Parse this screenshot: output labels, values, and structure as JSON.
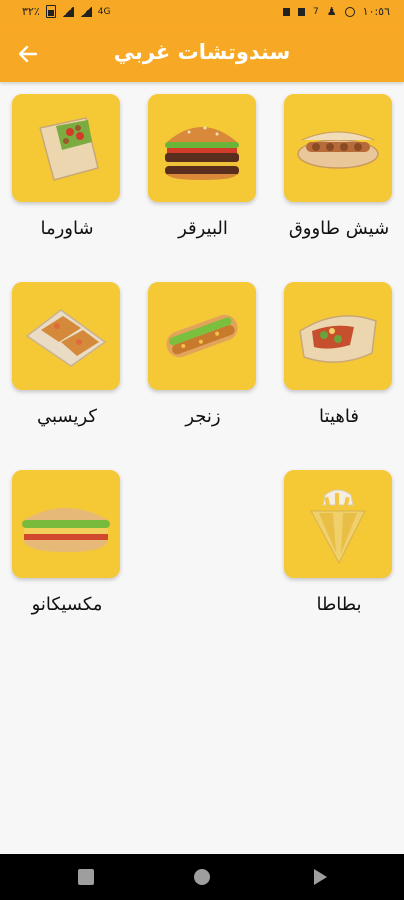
{
  "status_bar": {
    "time": "١٠:٥٦",
    "battery": "٣٢٪",
    "network": "4G"
  },
  "app_bar": {
    "title": "سندوتشات غربي"
  },
  "items": [
    {
      "label": "شيش طاووق",
      "icon": "shish-tawook-sandwich-icon"
    },
    {
      "label": "البيرقر",
      "icon": "burger-icon"
    },
    {
      "label": "شاورما",
      "icon": "shawarma-wrap-icon"
    },
    {
      "label": "فاهيتا",
      "icon": "fajita-wrap-icon"
    },
    {
      "label": "زنجر",
      "icon": "zinger-sandwich-icon"
    },
    {
      "label": "كريسبي",
      "icon": "crispy-wrap-icon"
    },
    {
      "label": "بطاطا",
      "icon": "fries-icon"
    },
    {
      "label": "مكسيكانو",
      "icon": "mexicano-sandwich-icon"
    }
  ],
  "colors": {
    "accent": "#f7a824",
    "tile": "#f5c836"
  }
}
